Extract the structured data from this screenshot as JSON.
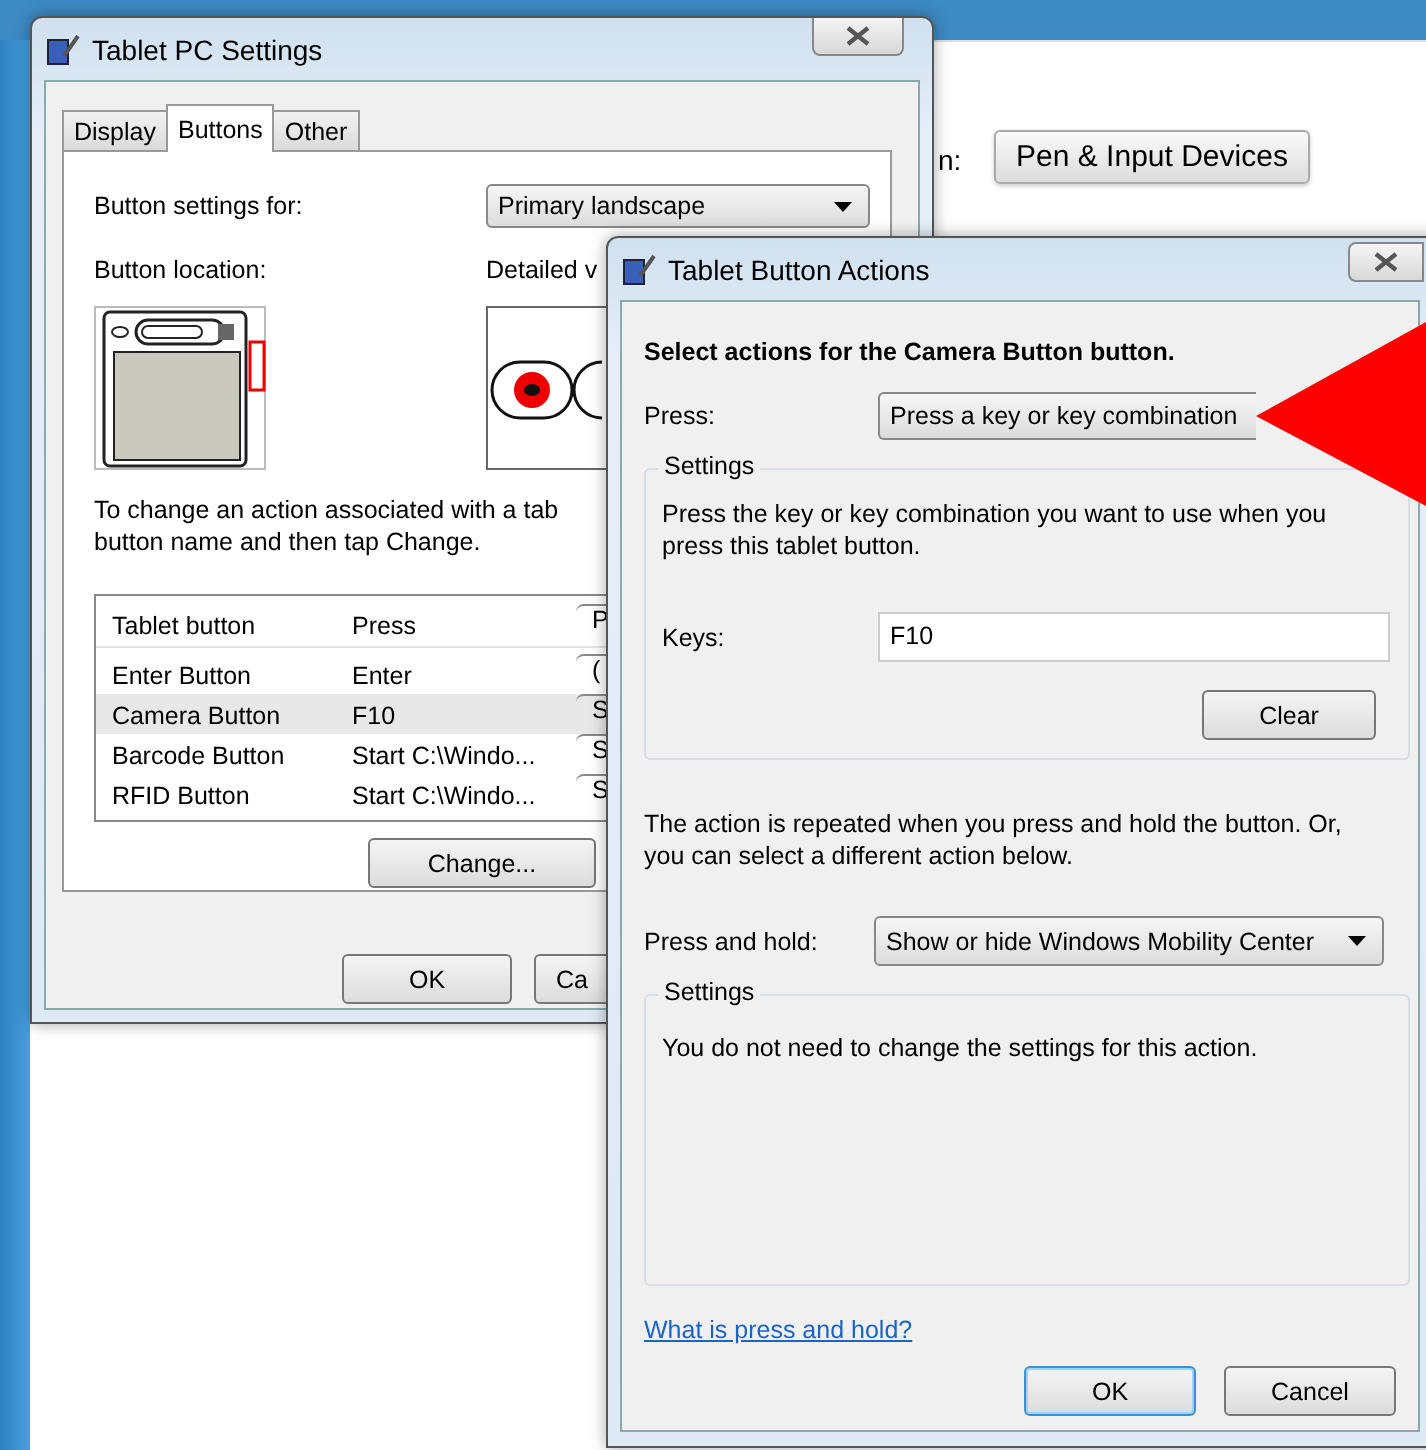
{
  "background_page": {
    "label_fragment": "n:",
    "button": "Pen & Input Devices"
  },
  "tablet_pc_settings": {
    "title": "Tablet PC Settings",
    "tabs": [
      {
        "label": "Display",
        "selected": false
      },
      {
        "label": "Buttons",
        "selected": true
      },
      {
        "label": "Other",
        "selected": false
      }
    ],
    "button_settings_for": {
      "label": "Button settings for:",
      "value": "Primary landscape"
    },
    "button_location_label": "Button location:",
    "detailed_view_label": "Detailed v",
    "instructions": "To change an action associated with a tab\nbutton name and then tap Change.",
    "table": {
      "columns": [
        "Tablet button",
        "Press",
        "P"
      ],
      "rows": [
        {
          "cells": [
            "Enter Button",
            "Enter",
            "("
          ],
          "selected": false
        },
        {
          "cells": [
            "Camera Button",
            "F10",
            "S"
          ],
          "selected": true
        },
        {
          "cells": [
            "Barcode Button",
            "Start C:\\Windo...",
            "S"
          ],
          "selected": false
        },
        {
          "cells": [
            "RFID Button",
            "Start C:\\Windo...",
            "S"
          ],
          "selected": false
        }
      ]
    },
    "change_button": "Change...",
    "buttons": [
      "OK",
      "Ca"
    ]
  },
  "tablet_button_actions": {
    "title": "Tablet Button Actions",
    "heading": "Select actions for the Camera Button button.",
    "press": {
      "label": "Press:",
      "value": "Press a key or key combination"
    },
    "press_settings": {
      "legend": "Settings",
      "description": "Press the key or key combination you want to use when you\npress this tablet button.",
      "keys_label": "Keys:",
      "keys_value": "F10",
      "clear_button": "Clear"
    },
    "repeat_note": "The action is repeated when you press and hold the button. Or,\nyou can select a different action below.",
    "press_and_hold": {
      "label": "Press and hold:",
      "value": "Show or hide Windows Mobility Center"
    },
    "hold_settings": {
      "legend": "Settings",
      "description": "You do not need to change the settings for this action."
    },
    "help_link": "What is press and hold?",
    "buttons": [
      {
        "label": "OK",
        "default": true
      },
      {
        "label": "Cancel",
        "default": false
      }
    ]
  }
}
